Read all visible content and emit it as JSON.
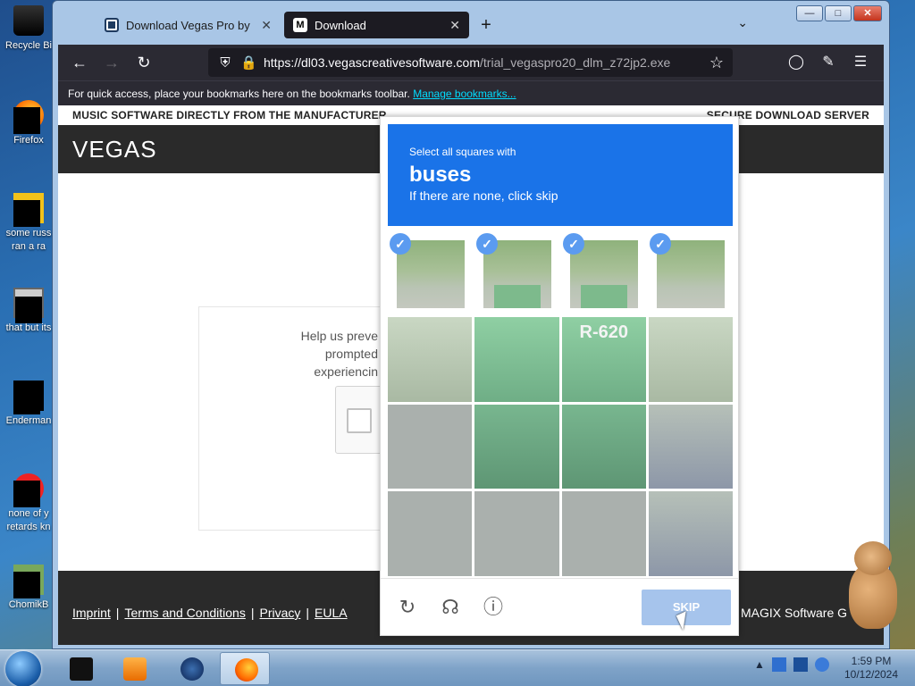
{
  "desktop": {
    "icons": [
      {
        "label": "Recycle Bi",
        "icon": "recycle-bin-icon"
      },
      {
        "label": "Firefox",
        "icon": "firefox-icon"
      },
      {
        "label": "some russ\nran a ra",
        "icon": "file-icon"
      },
      {
        "label": "that but its",
        "icon": "folder-icon"
      },
      {
        "label": "Enderman",
        "icon": "app-icon"
      },
      {
        "label": "none of y\nretards kn",
        "icon": "opera-icon"
      },
      {
        "label": "ChomikB",
        "icon": "app-icon"
      }
    ]
  },
  "browser": {
    "tabs": [
      {
        "title": "Download Vegas Pro by MAGIX",
        "favicon": "V"
      },
      {
        "title": "Download",
        "favicon": "M"
      }
    ],
    "url_domain": "https://dl03.vegascreativesoftware.com",
    "url_path": "/trial_vegaspro20_dlm_z72jp2.exe",
    "bookmarks_text": "For quick access, place your bookmarks here on the bookmarks toolbar.",
    "bookmarks_link": "Manage bookmarks..."
  },
  "page": {
    "top_left": "MUSIC SOFTWARE DIRECTLY FROM THE MANUFACTURER",
    "top_right": "SECURE DOWNLOAD SERVER",
    "brand": "VEGAS",
    "help_lines": [
      "Help us preve",
      "prompted",
      "experiencin"
    ],
    "footer_links": [
      "Imprint",
      "Terms and Conditions",
      "Privacy",
      "EULA"
    ],
    "footer_copy": "MAGIX Software G"
  },
  "captcha": {
    "line1": "Select all squares with",
    "target": "buses",
    "line3": "If there are none, click skip",
    "bus_number": "R-620",
    "skip_label": "SKIP",
    "colors": {
      "header": "#1a73e8",
      "check": "#5b9bf0",
      "skip": "#a6c4ec"
    }
  },
  "taskbar": {
    "time": "1:59 PM",
    "date": "10/12/2024"
  }
}
